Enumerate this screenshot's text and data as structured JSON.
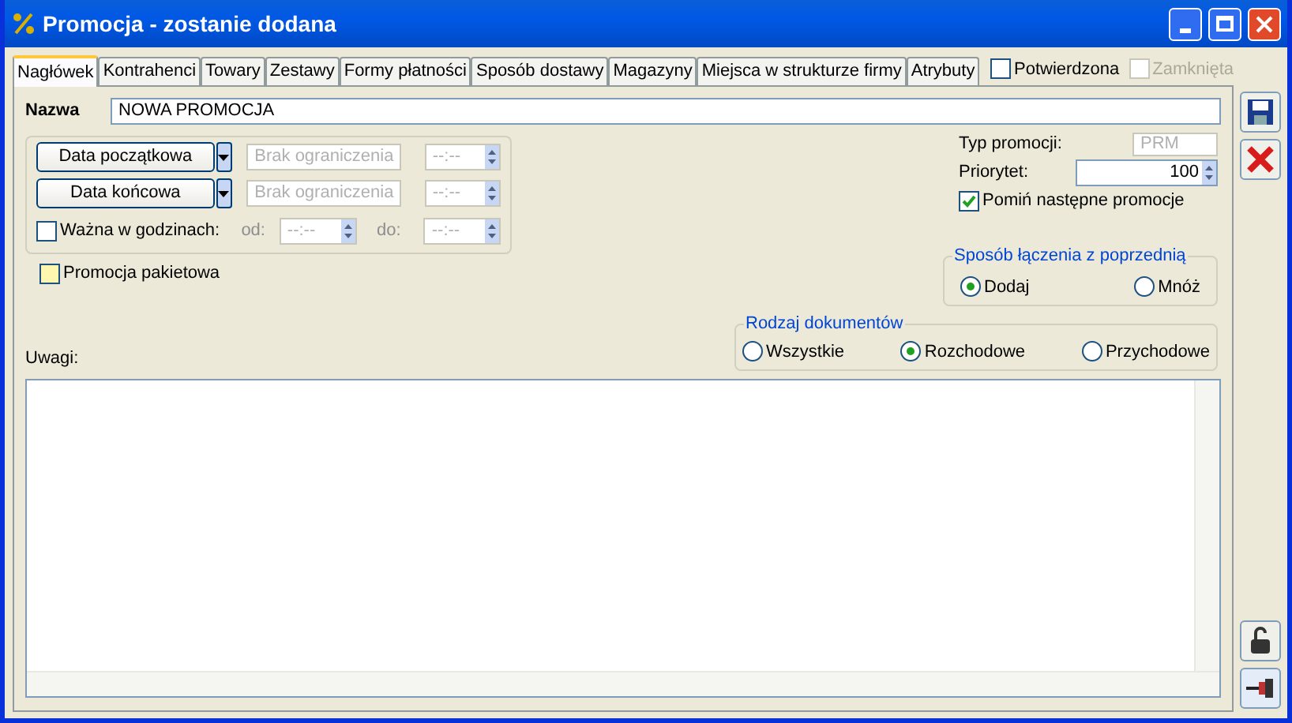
{
  "window": {
    "title": "Promocja - zostanie dodana"
  },
  "tabs": [
    {
      "label": "Nagłówek",
      "selected": true
    },
    {
      "label": "Kontrahenci",
      "selected": false
    },
    {
      "label": "Towary",
      "selected": false
    },
    {
      "label": "Zestawy",
      "selected": false
    },
    {
      "label": "Formy płatności",
      "selected": false
    },
    {
      "label": "Sposób dostawy",
      "selected": false
    },
    {
      "label": "Magazyny",
      "selected": false
    },
    {
      "label": "Miejsca w strukturze firmy",
      "selected": false
    },
    {
      "label": "Atrybuty",
      "selected": false
    }
  ],
  "header_checkboxes": [
    {
      "label": "Potwierdzona",
      "checked": false,
      "disabled": false
    },
    {
      "label": "Zamknięta",
      "checked": false,
      "disabled": true
    }
  ],
  "name": {
    "label": "Nazwa",
    "value": "NOWA PROMOCJA"
  },
  "date_rows": [
    {
      "button": "Data początkowa",
      "value": "Brak ograniczenia",
      "time": "--:--"
    },
    {
      "button": "Data końcowa",
      "value": "Brak ograniczenia",
      "time": "--:--"
    }
  ],
  "hours": {
    "label": "Ważna w godzinach:",
    "checked": false,
    "from_label": "od:",
    "from_value": "--:--",
    "to_label": "do:",
    "to_value": "--:--"
  },
  "package": {
    "label": "Promocja pakietowa",
    "checked": false
  },
  "type": {
    "label": "Typ promocji:",
    "value": "PRM"
  },
  "priority": {
    "label": "Priorytet:",
    "value": "100"
  },
  "skip_next": {
    "label": "Pomiń następne promocje",
    "checked": true
  },
  "combine": {
    "title": "Sposób łączenia z poprzednią",
    "options": [
      {
        "label": "Dodaj",
        "selected": true
      },
      {
        "label": "Mnóż",
        "selected": false
      }
    ]
  },
  "doc_types": {
    "title": "Rodzaj dokumentów",
    "options": [
      {
        "label": "Wszystkie",
        "selected": false
      },
      {
        "label": "Rozchodowe",
        "selected": true
      },
      {
        "label": "Przychodowe",
        "selected": false
      }
    ]
  },
  "notes": {
    "label": "Uwagi:"
  }
}
